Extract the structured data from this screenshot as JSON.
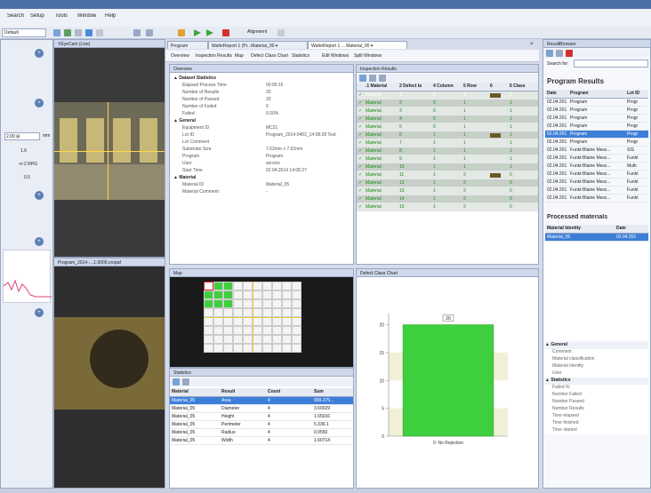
{
  "menu": {
    "items": [
      "Search",
      "Setup",
      "Tools",
      "Window",
      "Help"
    ],
    "profile": "Default",
    "alignment": "Alignment"
  },
  "left_dock": {
    "field_value": "2.00 ⊞",
    "field_unit": "mm",
    "values": [
      "1.6",
      "+/-2 RPG",
      "0.5"
    ]
  },
  "camera_panel": {
    "title": "VEyeCam (Live)"
  },
  "image_panel": {
    "title": "Program_2014-....1.0000.cropaf"
  },
  "main_tabs": [
    "Program",
    "WaferReport 1 (Pr...Material_00 ▾",
    "WaferReport 1 ... Material_00 ▾"
  ],
  "sub_tabs": [
    "Overview",
    "Inspection Results",
    "Map",
    "Defect Class Chart",
    "Statistics",
    "Edit Windows",
    "Split Windows"
  ],
  "overview": {
    "title": "Overview",
    "groups": [
      {
        "name": "Dataset Statistics",
        "rows": [
          [
            "Elapsed Process Time",
            "00:00:16"
          ],
          [
            "Number of Results",
            "20"
          ],
          [
            "Number of Passed",
            "20"
          ],
          [
            "Number of Failed",
            "0"
          ],
          [
            "Failed",
            "0.00%"
          ]
        ]
      },
      {
        "name": "General",
        "rows": [
          [
            "Equipment ID",
            "MC21"
          ],
          [
            "Lot ID",
            "Program_2014-0402_14:08:28 Test"
          ],
          [
            "Lot Comment",
            ""
          ],
          [
            "Substrate Size",
            "7.62mm x 7.62mm"
          ],
          [
            "Program",
            "Program"
          ],
          [
            "User",
            "service"
          ],
          [
            "Start Time",
            "02.04.2014 14:08:27"
          ]
        ]
      },
      {
        "name": "Material",
        "rows": [
          [
            "Material ID",
            "Material_05"
          ],
          [
            "Material Comment",
            "-"
          ]
        ]
      }
    ]
  },
  "inspection": {
    "title": "Inspection Results",
    "headers": [
      "",
      ".1 Material",
      "2 Defect la",
      "4 Column",
      "5 Row",
      "6",
      "6 Class"
    ],
    "rows": [
      [
        "Material",
        "1",
        "0",
        "1",
        "",
        "1"
      ],
      [
        "Material",
        "2",
        "0",
        "1",
        "",
        "1"
      ],
      [
        "Material",
        "3",
        "0",
        "1",
        "",
        "1"
      ],
      [
        "Material",
        "4",
        "0",
        "1",
        "",
        "1"
      ],
      [
        "Material",
        "5",
        "0",
        "1",
        "",
        "1"
      ],
      [
        "Material",
        "6",
        "1",
        "1",
        "",
        "1"
      ],
      [
        "Material",
        "7",
        "1",
        "1",
        "",
        "1"
      ],
      [
        "Material",
        "8",
        "1",
        "1",
        "",
        "1"
      ],
      [
        "Material",
        "9",
        "1",
        "1",
        "",
        "1"
      ],
      [
        "Material",
        "10",
        "1",
        "1",
        "",
        "1"
      ],
      [
        "Material",
        "11",
        "1",
        "2",
        "",
        "0"
      ],
      [
        "Material",
        "12",
        "1",
        "2",
        "",
        "0"
      ],
      [
        "Material",
        "13",
        "1",
        "2",
        "",
        "0"
      ],
      [
        "Material",
        "14",
        "1",
        "2",
        "",
        "0"
      ],
      [
        "Material",
        "15",
        "1",
        "2",
        "",
        "0"
      ]
    ]
  },
  "map": {
    "title": "Map"
  },
  "statistics": {
    "title": "Statistics",
    "headers": [
      "Material",
      "Result",
      "Count",
      "Sum"
    ],
    "rows": [
      [
        "Material_05",
        "Area",
        "4",
        "999.375..."
      ],
      [
        "Material_05",
        "Diameter",
        "4",
        "3.60029"
      ],
      [
        "Material_05",
        "Height",
        "4",
        "1.65016"
      ],
      [
        "Material_05",
        "Perimeter",
        "4",
        "5.336.1"
      ],
      [
        "Material_05",
        "Radius",
        "4",
        "0.0550"
      ],
      [
        "Material_05",
        "Width",
        "4",
        "1.60714"
      ]
    ]
  },
  "chart_panel": {
    "title": "Defect Class Chart"
  },
  "chart_data": {
    "type": "bar",
    "categories": [
      "0: No Rejection"
    ],
    "values": [
      20
    ],
    "bar_label": "20",
    "ylim": [
      0,
      22
    ],
    "yticks": [
      0,
      5,
      10,
      15,
      20
    ],
    "colors": {
      "bar": "#3ecf3e"
    }
  },
  "right": {
    "title": "ResultBrowser",
    "search_label": "Search for:",
    "section": "Program Results",
    "headers": [
      "Date",
      "Program",
      "Lot ID"
    ],
    "rows": [
      [
        "02.04.201",
        "Program",
        "Progr"
      ],
      [
        "02.04.201",
        "Program",
        "Progr"
      ],
      [
        "02.04.201",
        "Program",
        "Progr"
      ],
      [
        "02.04.201",
        "Program",
        "Progr"
      ],
      [
        "02.04.201",
        "Program",
        "Progr"
      ],
      [
        "02.04.201",
        "Program",
        "Progr"
      ],
      [
        "02.04.201",
        "Funkt-Blaine Mess...",
        "SIS"
      ],
      [
        "02.04.201",
        "Funkt-Blaine Mess...",
        "Funkt"
      ],
      [
        "02.04.201",
        "Funkt-Blaine Mess...",
        "Multi"
      ],
      [
        "02.04.201",
        "Funkt-Blaine Mess...",
        "Funkt"
      ],
      [
        "02.04.201",
        "Funkt-Blaine Mess...",
        "Funkt"
      ],
      [
        "02.04.201",
        "Funkt-Blaine Mess...",
        "Funkt"
      ],
      [
        "02.04.201",
        "Funkt-Blaine Mess...",
        "Funkt"
      ]
    ],
    "processed_title": "Processed materials",
    "processed_headers": [
      "Material Identity",
      "Date"
    ],
    "processed_rows": [
      [
        "Material_05",
        "02.04.201"
      ]
    ],
    "props": [
      {
        "name": "General",
        "rows": [
          "Comment",
          "Material classification",
          "Material identity",
          "User"
        ]
      },
      {
        "name": "Statistics",
        "rows": [
          "Failed %",
          "Number Failed",
          "Number Passed",
          "Number Results",
          "Time elapsed",
          "Time finished",
          "Time started"
        ]
      }
    ]
  }
}
